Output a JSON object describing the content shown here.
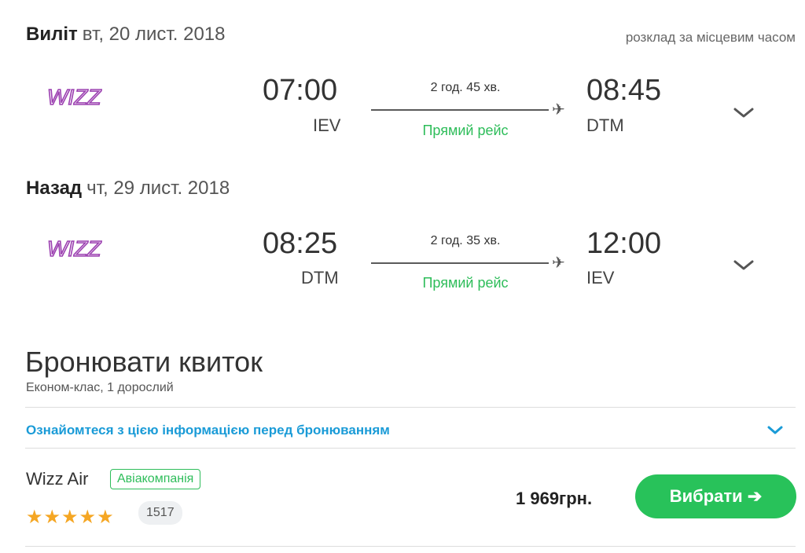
{
  "outbound": {
    "label": "Виліт",
    "date": "вт, 20 лист. 2018",
    "local_time_note": "розклад за місцевим часом",
    "dep_time": "07:00",
    "dep_code": "IEV",
    "duration": "2 год. 45 хв.",
    "direct": "Прямий рейс",
    "arr_time": "08:45",
    "arr_code": "DTM",
    "airline_logo": "WIZZ"
  },
  "return": {
    "label": "Назад",
    "date": "чт, 29 лист. 2018",
    "dep_time": "08:25",
    "dep_code": "DTM",
    "duration": "2 год. 35 хв.",
    "direct": "Прямий рейс",
    "arr_time": "12:00",
    "arr_code": "IEV",
    "airline_logo": "WIZZ"
  },
  "booking": {
    "title": "Бронювати квиток",
    "subtitle": "Економ-клас, 1 дорослий",
    "info_link": "Ознайомтеся з цією інформацією перед бронюванням",
    "airline": "Wizz Air",
    "badge": "Авіакомпанія",
    "rating_stars": 5,
    "reviews_count": "1517",
    "price": "1 969грн.",
    "select_label": "Вибрати ➔"
  },
  "colors": {
    "accent_green": "#28c25a",
    "link_blue": "#1a9bd7",
    "star": "#f5a623",
    "logo_purple": "#9b3fb0"
  }
}
